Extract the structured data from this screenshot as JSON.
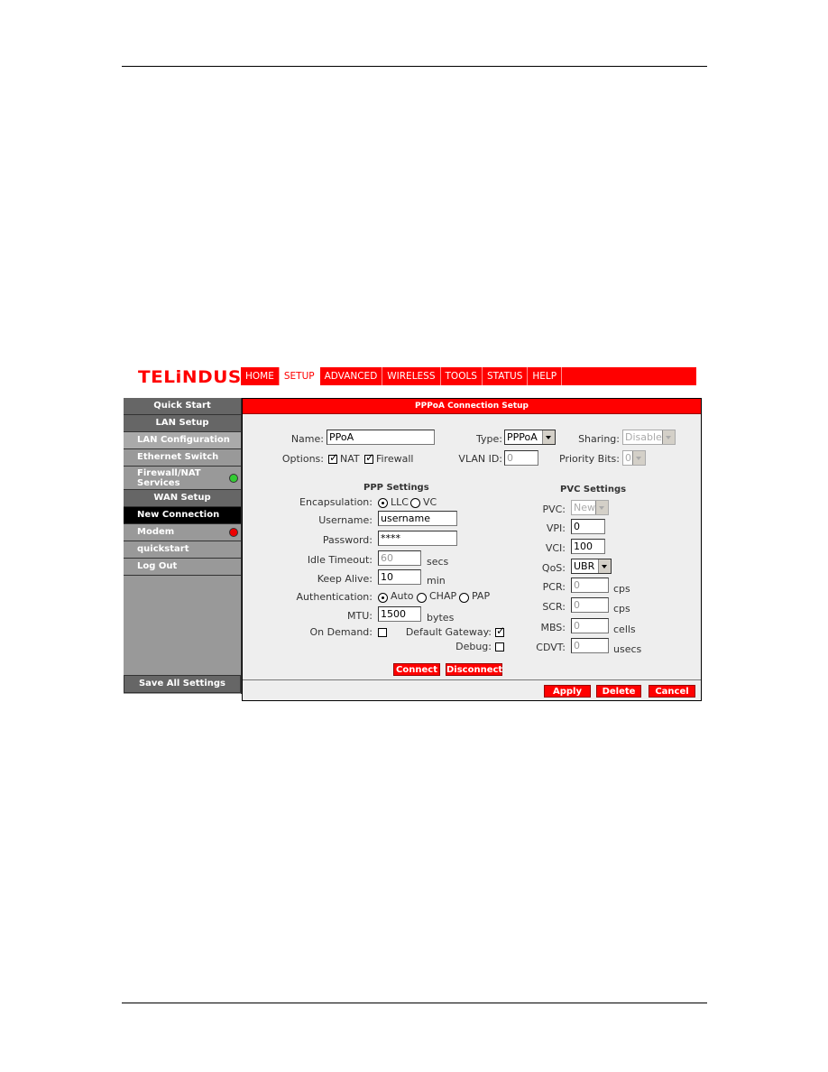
{
  "brand": {
    "logo": "TELiNDUS",
    "accent": "#ff0000"
  },
  "nav": {
    "tabs": [
      {
        "label": "HOME",
        "active": false
      },
      {
        "label": "SETUP",
        "active": true
      },
      {
        "label": "ADVANCED",
        "active": false
      },
      {
        "label": "WIRELESS",
        "active": false
      },
      {
        "label": "TOOLS",
        "active": false
      },
      {
        "label": "STATUS",
        "active": false
      },
      {
        "label": "HELP",
        "active": false
      }
    ]
  },
  "sidebar": {
    "items": [
      {
        "label": "Quick Start"
      },
      {
        "label": "LAN Setup"
      },
      {
        "label": "LAN Configuration"
      },
      {
        "label": "Ethernet Switch"
      },
      {
        "label": "Firewall/NAT Services",
        "line1": "Firewall/NAT",
        "line2": "Services",
        "status": "green"
      },
      {
        "label": "WAN Setup"
      },
      {
        "label": "New Connection"
      },
      {
        "label": "Modem",
        "status": "red"
      },
      {
        "label": "quickstart"
      },
      {
        "label": "Log Out"
      }
    ],
    "save_label": "Save All Settings"
  },
  "panel": {
    "title": "PPPoA Connection Setup",
    "name_label": "Name:",
    "name_value": "PPoA",
    "type_label": "Type:",
    "type_value": "PPPoA",
    "sharing_label": "Sharing:",
    "sharing_value": "Disable",
    "options_label": "Options:",
    "nat_label": "NAT",
    "nat_checked": true,
    "firewall_label": "Firewall",
    "firewall_checked": true,
    "vlan_label": "VLAN ID:",
    "vlan_value": "0",
    "priority_label": "Priority Bits:",
    "priority_value": "0",
    "ppp": {
      "title": "PPP Settings",
      "encap_label": "Encapsulation:",
      "encap_options": [
        "LLC",
        "VC"
      ],
      "encap_selected": "LLC",
      "username_label": "Username:",
      "username_value": "username",
      "password_label": "Password:",
      "password_value": "****",
      "idle_label": "Idle Timeout:",
      "idle_value": "60",
      "idle_unit": "secs",
      "keepalive_label": "Keep Alive:",
      "keepalive_value": "10",
      "keepalive_unit": "min",
      "auth_label": "Authentication:",
      "auth_options": [
        "Auto",
        "CHAP",
        "PAP"
      ],
      "auth_selected": "Auto",
      "mtu_label": "MTU:",
      "mtu_value": "1500",
      "mtu_unit": "bytes",
      "ondemand_label": "On Demand:",
      "ondemand_checked": false,
      "defgw_label": "Default Gateway:",
      "defgw_checked": true,
      "debug_label": "Debug:",
      "debug_checked": false,
      "connect_label": "Connect",
      "disconnect_label": "Disconnect"
    },
    "pvc": {
      "title": "PVC Settings",
      "pvc_label": "PVC:",
      "pvc_value": "New",
      "vpi_label": "VPI:",
      "vpi_value": "0",
      "vci_label": "VCI:",
      "vci_value": "100",
      "qos_label": "QoS:",
      "qos_value": "UBR",
      "pcr_label": "PCR:",
      "pcr_value": "0",
      "pcr_unit": "cps",
      "scr_label": "SCR:",
      "scr_value": "0",
      "scr_unit": "cps",
      "mbs_label": "MBS:",
      "mbs_value": "0",
      "mbs_unit": "cells",
      "cdvt_label": "CDVT:",
      "cdvt_value": "0",
      "cdvt_unit": "usecs"
    },
    "apply_label": "Apply",
    "delete_label": "Delete",
    "cancel_label": "Cancel"
  }
}
